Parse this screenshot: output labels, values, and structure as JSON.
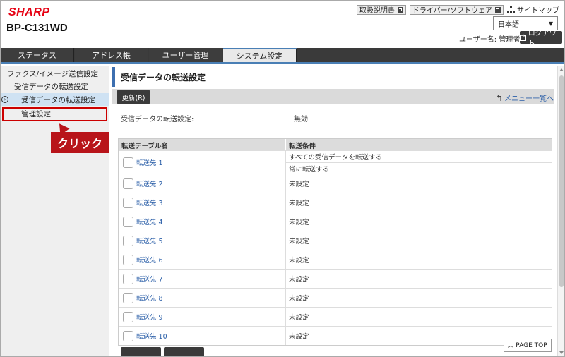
{
  "header": {
    "brand": "SHARP",
    "model": "BP-C131WD",
    "links": [
      {
        "label": "取扱説明書",
        "icon": "external-link-icon"
      },
      {
        "label": "ドライバー/ソフトウェア",
        "icon": "external-link-icon"
      }
    ],
    "sitemap_label": "サイトマップ",
    "language": "日本語",
    "user_label": "ユーザー名: 管理者",
    "logout_label": "ログアウト"
  },
  "tabs": [
    {
      "label": "ステータス",
      "active": false
    },
    {
      "label": "アドレス帳",
      "active": false
    },
    {
      "label": "ユーザー管理",
      "active": false
    },
    {
      "label": "システム設定",
      "active": true
    }
  ],
  "sidebar": {
    "items": [
      {
        "label": "ファクス/イメージ送信設定"
      },
      {
        "label": "受信データの転送設定"
      },
      {
        "label": "受信データの転送設定"
      },
      {
        "label": "管理設定"
      }
    ]
  },
  "callout": {
    "label": "クリック"
  },
  "main": {
    "title": "受信データの転送設定",
    "refresh_label": "更新(R)",
    "menu_link": "メニュー一覧へ",
    "setting_label": "受信データの転送設定:",
    "setting_value": "無効",
    "table": {
      "headers": [
        "転送テーブル名",
        "転送条件"
      ],
      "rows": [
        {
          "name": "転送先 1",
          "conditions": [
            "すべての受信データを転送する",
            "常に転送する"
          ]
        },
        {
          "name": "転送先 2",
          "conditions": [
            "未設定"
          ]
        },
        {
          "name": "転送先 3",
          "conditions": [
            "未設定"
          ]
        },
        {
          "name": "転送先 4",
          "conditions": [
            "未設定"
          ]
        },
        {
          "name": "転送先 5",
          "conditions": [
            "未設定"
          ]
        },
        {
          "name": "転送先 6",
          "conditions": [
            "未設定"
          ]
        },
        {
          "name": "転送先 7",
          "conditions": [
            "未設定"
          ]
        },
        {
          "name": "転送先 8",
          "conditions": [
            "未設定"
          ]
        },
        {
          "name": "転送先 9",
          "conditions": [
            "未設定"
          ]
        },
        {
          "name": "転送先 10",
          "conditions": [
            "未設定"
          ]
        }
      ]
    },
    "page_top_label": "PAGE TOP"
  },
  "colors": {
    "brand": "#e60012",
    "accent": "#3d6fb0",
    "link": "#2b5fa8",
    "highlight": "#cc0000"
  }
}
